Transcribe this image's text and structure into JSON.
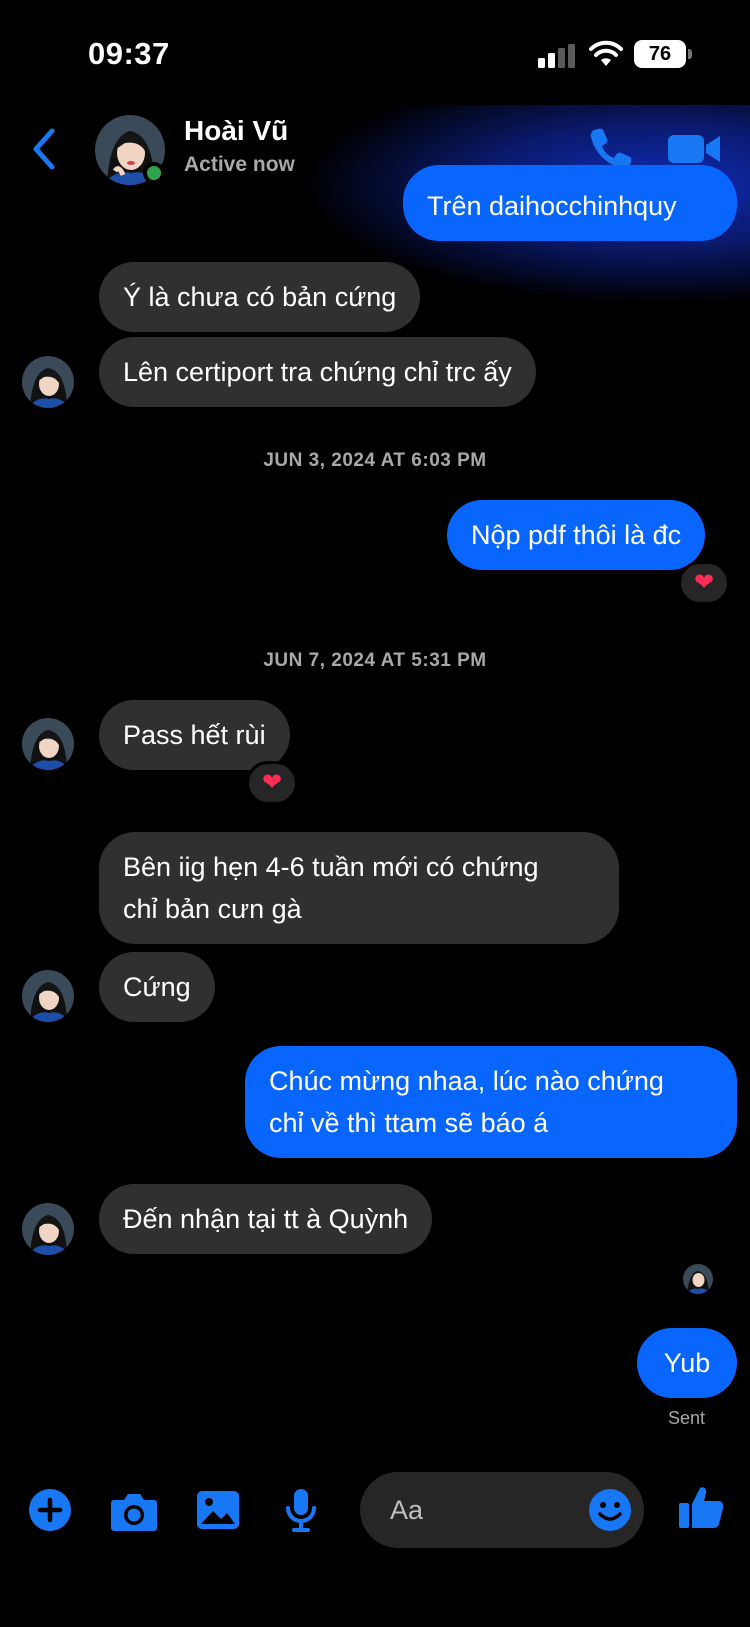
{
  "status_bar": {
    "time": "09:37",
    "battery": "76"
  },
  "header": {
    "contact_name": "Hoài Vũ",
    "contact_status": "Active now"
  },
  "messages": [
    {
      "text": "Trên daihocchinhquy"
    },
    {
      "text": "Ý là chưa có bản cứng"
    },
    {
      "text": "Lên certiport tra chứng chỉ trc ấy"
    },
    {
      "text": "Nộp pdf thôi là đc",
      "reaction": "❤"
    },
    {
      "text": "Pass hết rùi",
      "reaction": "❤"
    },
    {
      "text": "Bên iig hẹn 4-6 tuần mới có chứng",
      "text2": "chỉ bản cưn  gà"
    },
    {
      "text": "Cứng"
    },
    {
      "text": "Chúc mừng nhaa, lúc nào chứng",
      "text2": "chỉ về thì ttam sẽ báo á"
    },
    {
      "text": "Đến nhận tại tt à Quỳnh"
    },
    {
      "text": "Yub"
    }
  ],
  "timestamps": [
    "JUN 3, 2024 AT 6:03 PM",
    "JUN 7, 2024 AT 5:31 PM"
  ],
  "sent_status": "Sent",
  "composer": {
    "placeholder": "Aa"
  },
  "colors": {
    "accent": "#0866ff",
    "incoming_bubble": "#303030",
    "online": "#31a24c",
    "reaction": "#ff2d55"
  }
}
